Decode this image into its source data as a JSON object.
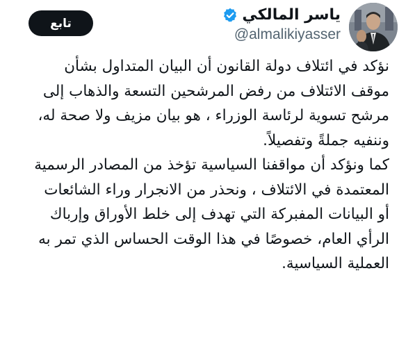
{
  "author": {
    "display_name": "ياسر المالكي",
    "handle": "@almalikiyasser",
    "verified_icon": "verified-badge-icon",
    "avatar_icon": "avatar-photo"
  },
  "follow_button": {
    "label": "تابع"
  },
  "tweet": {
    "lines": [
      "نؤكد في ائتلاف دولة القانون أن البيان المتداول بشأن",
      "موقف الائتلاف من رفض المرشحين التسعة والذهاب إلى",
      "مرشح تسوية لرئاسة الوزراء ، هو بيان مزيف ولا صحة له،",
      "وننفيه جملةً وتفصيلاً.",
      "كما ونؤكد أن مواقفنا السياسية تؤخذ من المصادر الرسمية",
      "المعتمدة في الائتلاف ، ونحذر من الانجرار وراء الشائعات",
      "أو البيانات المفبركة التي تهدف إلى خلط الأوراق وإرباك",
      "الرأي العام، خصوصًا في هذا الوقت الحساس الذي تمر به",
      "العملية السياسية."
    ]
  },
  "colors": {
    "text": "#0f1419",
    "secondary": "#536471",
    "verified": "#1d9bf0",
    "button_bg": "#0f1419",
    "button_text": "#ffffff",
    "background": "#ffffff"
  }
}
